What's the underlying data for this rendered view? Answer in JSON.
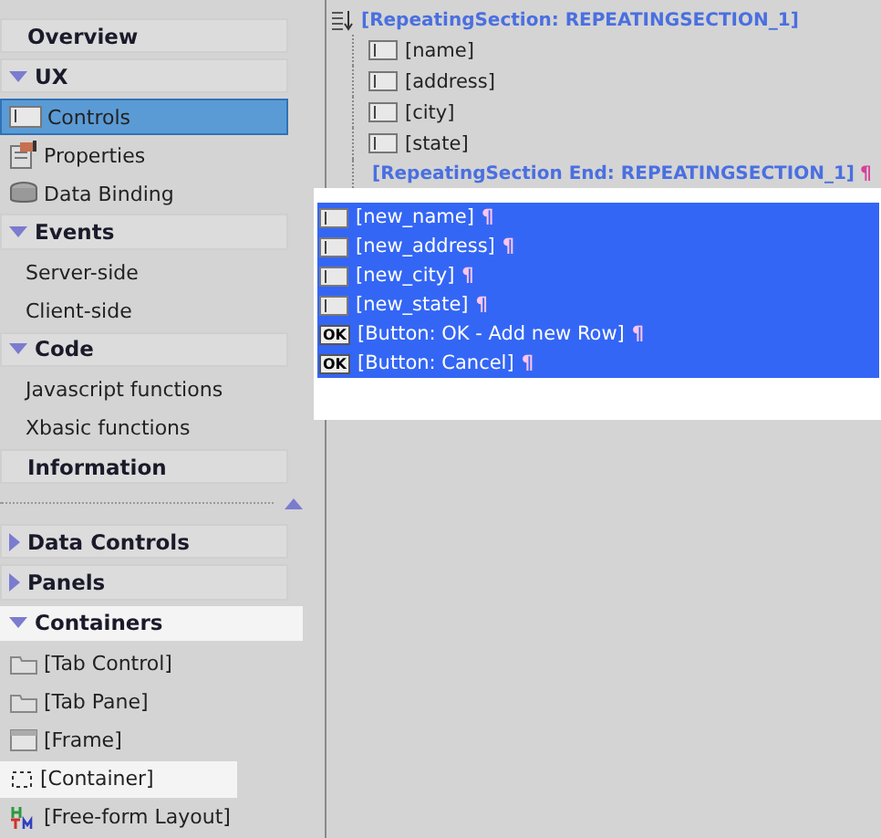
{
  "sidebar": {
    "sections": [
      {
        "kind": "header",
        "label": "Overview",
        "highlighted": false
      },
      {
        "kind": "header",
        "label": "UX",
        "expanded": true,
        "highlighted": false,
        "items": [
          {
            "kind": "textbox-item",
            "label": "Controls",
            "selected": true,
            "highlighted": false
          },
          {
            "kind": "props-item",
            "label": "Properties",
            "selected": false,
            "highlighted": false
          },
          {
            "kind": "db-item",
            "label": "Data Binding",
            "selected": false,
            "highlighted": false
          }
        ]
      },
      {
        "kind": "header",
        "label": "Events",
        "expanded": true,
        "highlighted": false,
        "items": [
          {
            "kind": "text-item",
            "label": "Server-side",
            "selected": false,
            "highlighted": false
          },
          {
            "kind": "text-item",
            "label": "Client-side",
            "selected": false,
            "highlighted": false
          }
        ]
      },
      {
        "kind": "header",
        "label": "Code",
        "expanded": true,
        "highlighted": false,
        "items": [
          {
            "kind": "text-item",
            "label": "Javascript functions",
            "selected": false,
            "highlighted": false
          },
          {
            "kind": "text-item",
            "label": "Xbasic functions",
            "selected": false,
            "highlighted": false
          }
        ]
      },
      {
        "kind": "header",
        "label": "Information",
        "highlighted": false
      },
      {
        "kind": "divider"
      },
      {
        "kind": "header",
        "label": "Data Controls",
        "expanded": false,
        "highlighted": false
      },
      {
        "kind": "header",
        "label": "Panels",
        "expanded": false,
        "highlighted": false
      },
      {
        "kind": "header",
        "label": "Containers",
        "expanded": true,
        "highlighted": true,
        "items": [
          {
            "kind": "folder-item",
            "label": "[Tab Control]",
            "selected": false,
            "highlighted": false
          },
          {
            "kind": "folder-item",
            "label": "[Tab Pane]",
            "selected": false,
            "highlighted": false
          },
          {
            "kind": "frame-item",
            "label": "[Frame]",
            "selected": false,
            "highlighted": false
          },
          {
            "kind": "dashed-item",
            "label": "[Container]",
            "selected": false,
            "highlighted": true
          },
          {
            "kind": "html-item",
            "label": "[Free-form Layout]",
            "selected": false,
            "highlighted": false
          }
        ]
      }
    ]
  },
  "design": {
    "section_start": "[RepeatingSection: REPEATINGSECTION_1]",
    "section_fields": [
      "[name]",
      "[address]",
      "[city]",
      "[state]"
    ],
    "section_end": "[RepeatingSection End: REPEATINGSECTION_1]",
    "section_end_mark": "¶",
    "lines": [
      {
        "kind": "textbox",
        "label": "[new_name]",
        "mark": "¶",
        "selected": true
      },
      {
        "kind": "textbox",
        "label": "[new_address]",
        "mark": "¶",
        "selected": true
      },
      {
        "kind": "textbox",
        "label": "[new_city]",
        "mark": "¶",
        "selected": true
      },
      {
        "kind": "textbox",
        "label": "[new_state]",
        "mark": "¶",
        "selected": true
      },
      {
        "kind": "button",
        "label": "[Button: OK - Add new Row]",
        "mark": "¶",
        "selected": true,
        "icon_text": "OK"
      },
      {
        "kind": "button",
        "label": "[Button: Cancel]",
        "mark": "¶",
        "selected": true,
        "icon_text": "OK"
      }
    ]
  }
}
